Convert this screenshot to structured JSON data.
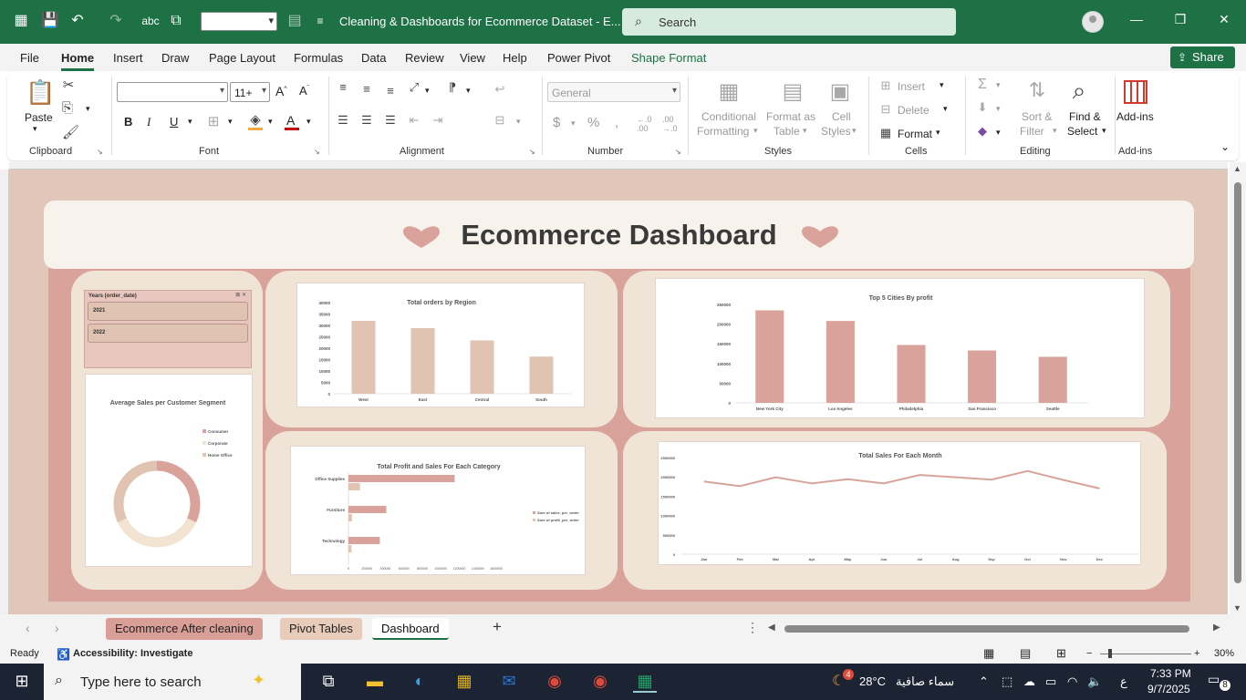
{
  "titlebar": {
    "doc_title": "Cleaning & Dashboards for Ecommerce Dataset  -  E...",
    "search_placeholder": "Search"
  },
  "menu": {
    "items": [
      "File",
      "Home",
      "Insert",
      "Draw",
      "Page Layout",
      "Formulas",
      "Data",
      "Review",
      "View",
      "Help",
      "Power Pivot",
      "Shape Format"
    ],
    "active": "Home",
    "share_label": "Share"
  },
  "ribbon": {
    "clipboard": {
      "label": "Clipboard",
      "paste": "Paste"
    },
    "font": {
      "label": "Font",
      "size": "11+"
    },
    "alignment": {
      "label": "Alignment"
    },
    "number": {
      "label": "Number",
      "format": "General"
    },
    "styles": {
      "label": "Styles",
      "conditional": "Conditional",
      "conditional2": "Formatting",
      "format_as": "Format as",
      "format_as2": "Table",
      "cell": "Cell",
      "cell2": "Styles"
    },
    "cells": {
      "label": "Cells",
      "insert": "Insert",
      "delete": "Delete",
      "format": "Format"
    },
    "editing": {
      "label": "Editing",
      "sort": "Sort &",
      "sort2": "Filter",
      "find": "Find &",
      "find2": "Select"
    },
    "addins": {
      "label": "Add-ins",
      "addins": "Add-ins"
    }
  },
  "dashboard": {
    "title": "Ecommerce Dashboard",
    "slicer": {
      "header": "Years (order_date)",
      "items": [
        "2021",
        "2022"
      ]
    },
    "colors": {
      "accent": "#d9a39b",
      "bar_light": "#e0c3b1",
      "bar_dark": "#d9a39b",
      "bg": "#e1c7b9"
    }
  },
  "chart_data": [
    {
      "type": "bar",
      "title": "Total orders by Region",
      "categories": [
        "West",
        "East",
        "Central",
        "South"
      ],
      "values": [
        32000,
        28800,
        23400,
        16300
      ],
      "yticks": [
        "0",
        "5000",
        "10000",
        "15000",
        "20000",
        "25000",
        "30000",
        "35000",
        "40000"
      ],
      "ylim": [
        0,
        40000
      ]
    },
    {
      "type": "bar",
      "title": "Top 5 Cities By profit",
      "categories": [
        "New York City",
        "Los Angeles",
        "Philadelphia",
        "San Francisco",
        "Seattle"
      ],
      "values": [
        235000,
        208000,
        147000,
        133000,
        117000
      ],
      "yticks": [
        "0",
        "50000",
        "100000",
        "150000",
        "200000",
        "250000"
      ],
      "ylim": [
        0,
        250000
      ]
    },
    {
      "type": "pie",
      "title": "Average Sales per Customer Segment",
      "legend": [
        "Consumer",
        "Corporate",
        "Home Office"
      ],
      "values": [
        0.32,
        0.36,
        0.32
      ]
    },
    {
      "type": "bar",
      "title": "Total Profit and Sales For Each Category",
      "categories": [
        "Office Supplies",
        "Furniture",
        "Technology"
      ],
      "series": [
        {
          "name": "Sum of sales_per_order",
          "values": [
            1150000,
            410000,
            340000
          ]
        },
        {
          "name": "Sum of profit_per_order",
          "values": [
            125000,
            38000,
            33000
          ]
        }
      ],
      "xticks": [
        "0",
        "200000",
        "400000",
        "600000",
        "800000",
        "1000000",
        "1200000",
        "1400000",
        "1600000"
      ],
      "xlim": [
        0,
        1600000
      ]
    },
    {
      "type": "line",
      "title": "Total Sales For Each Month",
      "categories": [
        "Jan",
        "Feb",
        "Mar",
        "Apr",
        "May",
        "Jun",
        "Jul",
        "Aug",
        "Sep",
        "Oct",
        "Nov",
        "Dec"
      ],
      "values": [
        1880000,
        1760000,
        1990000,
        1830000,
        1940000,
        1830000,
        2050000,
        1990000,
        1930000,
        2150000,
        1920000,
        1700000
      ],
      "yticks": [
        "0",
        "500000",
        "1000000",
        "1500000",
        "2000000",
        "2500000"
      ],
      "ylim": [
        0,
        2500000
      ]
    }
  ],
  "sheet_tabs": [
    "Ecommerce After cleaning",
    "Pivot Tables",
    "Dashboard"
  ],
  "active_tab": "Dashboard",
  "status": {
    "ready": "Ready",
    "accessibility": "Accessibility: Investigate",
    "zoom": "30%"
  },
  "taskbar": {
    "search_placeholder": "Type here to search",
    "weather_temp": "28°C",
    "weather_text": "سماء صافية",
    "lang": "ع",
    "time": "7:33 PM",
    "date": "9/7/2025",
    "notifications": "8",
    "weather_badge": "4"
  }
}
